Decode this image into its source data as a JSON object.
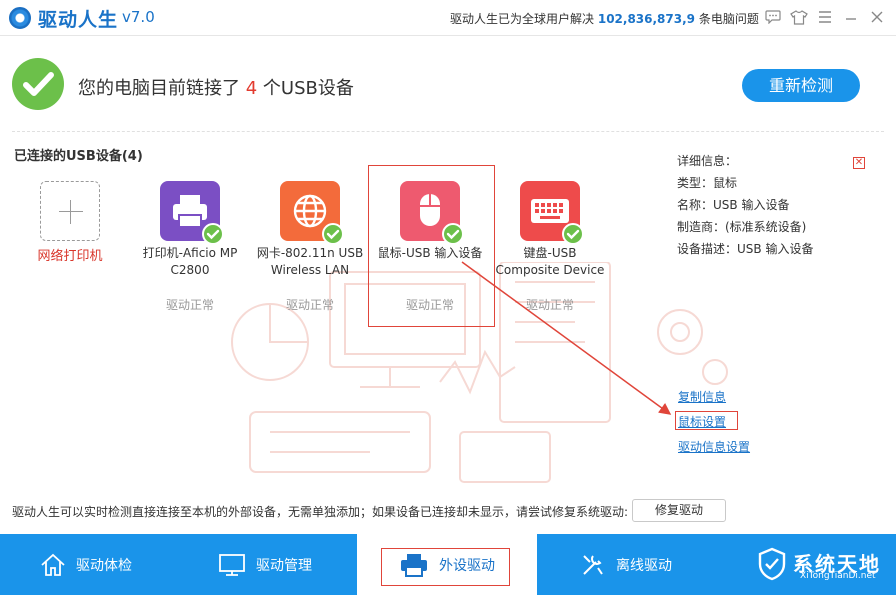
{
  "title_bar": {
    "app_name": "驱动人生",
    "version": "v7.0",
    "tagline_prefix": "驱动人生已为全球用户解决",
    "tagline_count": "102,836,873,9",
    "tagline_suffix": "条电脑问题",
    "icons": [
      "chat-icon",
      "shirt-icon",
      "menu-icon",
      "minimize-icon",
      "close-icon"
    ]
  },
  "header": {
    "status_prefix": "您的电脑目前链接了",
    "status_count": "4",
    "status_suffix": "个USB设备",
    "recheck_label": "重新检测"
  },
  "section_title": "已连接的USB设备(4)",
  "add_device": {
    "label": "网络打印机"
  },
  "devices": [
    {
      "name": "打印机-Aficio MP C2800",
      "status": "驱动正常",
      "color": "#7b4fc4",
      "icon": "printer-icon"
    },
    {
      "name": "网卡-802.11n USB Wireless LAN",
      "status": "驱动正常",
      "color": "#f36b3b",
      "icon": "globe-icon"
    },
    {
      "name": "鼠标-USB 输入设备",
      "status": "驱动正常",
      "color": "#ee5a6f",
      "icon": "mouse-icon"
    },
    {
      "name": "键盘-USB Composite Device",
      "status": "驱动正常",
      "color": "#ee4b4b",
      "icon": "keyboard-icon"
    }
  ],
  "detail": {
    "heading": "详细信息：",
    "type": "类型：鼠标",
    "name": "名称：USB 输入设备",
    "manufacturer": "制造商：(标准系统设备)",
    "description": "设备描述：USB 输入设备",
    "close_symbol": "✕"
  },
  "links": {
    "copy_info": "复制信息",
    "mouse_settings": "鼠标设置",
    "driver_info_settings": "驱动信息设置"
  },
  "hint": "驱动人生可以实时检测直接连接至本机的外部设备，无需单独添加；如果设备已连接却未显示，请尝试修复系统驱动:",
  "repair_label": "修复驱动",
  "bottom_nav": [
    {
      "label": "驱动体检",
      "icon": "home-icon"
    },
    {
      "label": "驱动管理",
      "icon": "monitor-icon"
    },
    {
      "label": "外设驱动",
      "icon": "printer-icon",
      "active": true
    },
    {
      "label": "离线驱动",
      "icon": "tools-icon"
    }
  ],
  "watermark": {
    "text": "系统天地",
    "url": "XiTongTianDi.net"
  },
  "colors": {
    "accent": "#1a94ea",
    "ok": "#6cc04a",
    "highlight": "#e0453a"
  }
}
